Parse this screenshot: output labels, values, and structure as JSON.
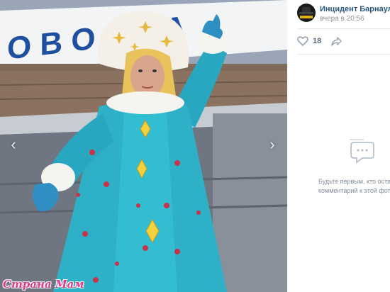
{
  "photo": {
    "description_icon": "photo",
    "sign_letters": "ОВОСЗА",
    "nav_prev_icon": "chevron-left-icon",
    "nav_next_icon": "chevron-right-icon"
  },
  "watermark": {
    "text": "Страна Мам",
    "color": "#e23a8d"
  },
  "post": {
    "author": "Инцидент Барнаул",
    "time": "вчера в 20:56",
    "avatar_icon": "avatar-icon"
  },
  "actions": {
    "like_count": "18",
    "like_icon": "heart-icon",
    "share_icon": "share-icon"
  },
  "comments": {
    "empty_line1": "Будьте первым, кто оста",
    "empty_line2": "комментарий к этой фотог",
    "icon": "comments-bubble-icon"
  },
  "colors": {
    "link": "#2a5885",
    "muted": "#939393",
    "icon": "#99a2ad",
    "panel_bg": "#ffffff"
  }
}
